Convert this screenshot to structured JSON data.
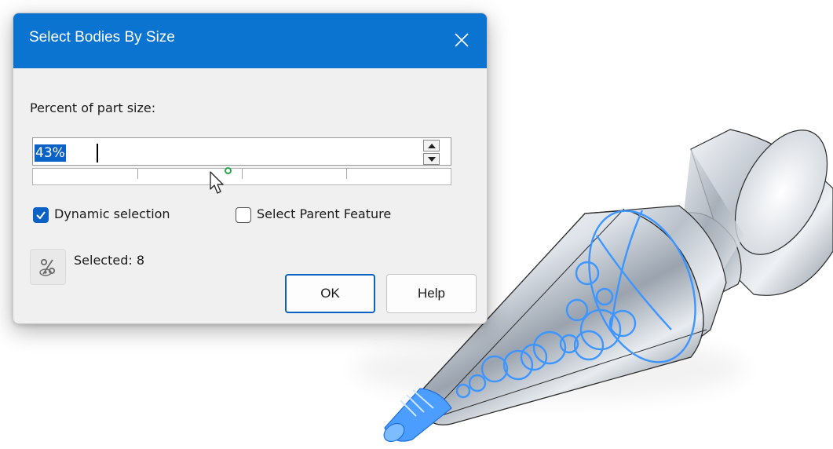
{
  "dialog": {
    "title": "Select Bodies By Size",
    "percent_label": "Percent of part size:",
    "percent_value": "43%",
    "slider_value_percent": 43,
    "dynamic_selection": {
      "label": "Dynamic selection",
      "checked": true
    },
    "select_parent_feature": {
      "label": "Select Parent Feature",
      "checked": false
    },
    "selected_text": "Selected: 8",
    "ok_label": "OK",
    "help_label": "Help"
  },
  "icons": {
    "close": "close-icon",
    "spin_up": "spin-up-icon",
    "spin_down": "spin-down-icon",
    "checkmark": "checkmark-icon",
    "percent_eye": "percent-eye-icon",
    "cursor": "mouse-cursor-icon"
  },
  "colors": {
    "titlebar": "#0b74d1",
    "selection_highlight": "#0b63c8",
    "checkbox_checked": "#0b62c4",
    "slider_thumb": "#2aa64a",
    "selected_edges": "#3d95ff",
    "part_metal": "#c0c8d2"
  }
}
